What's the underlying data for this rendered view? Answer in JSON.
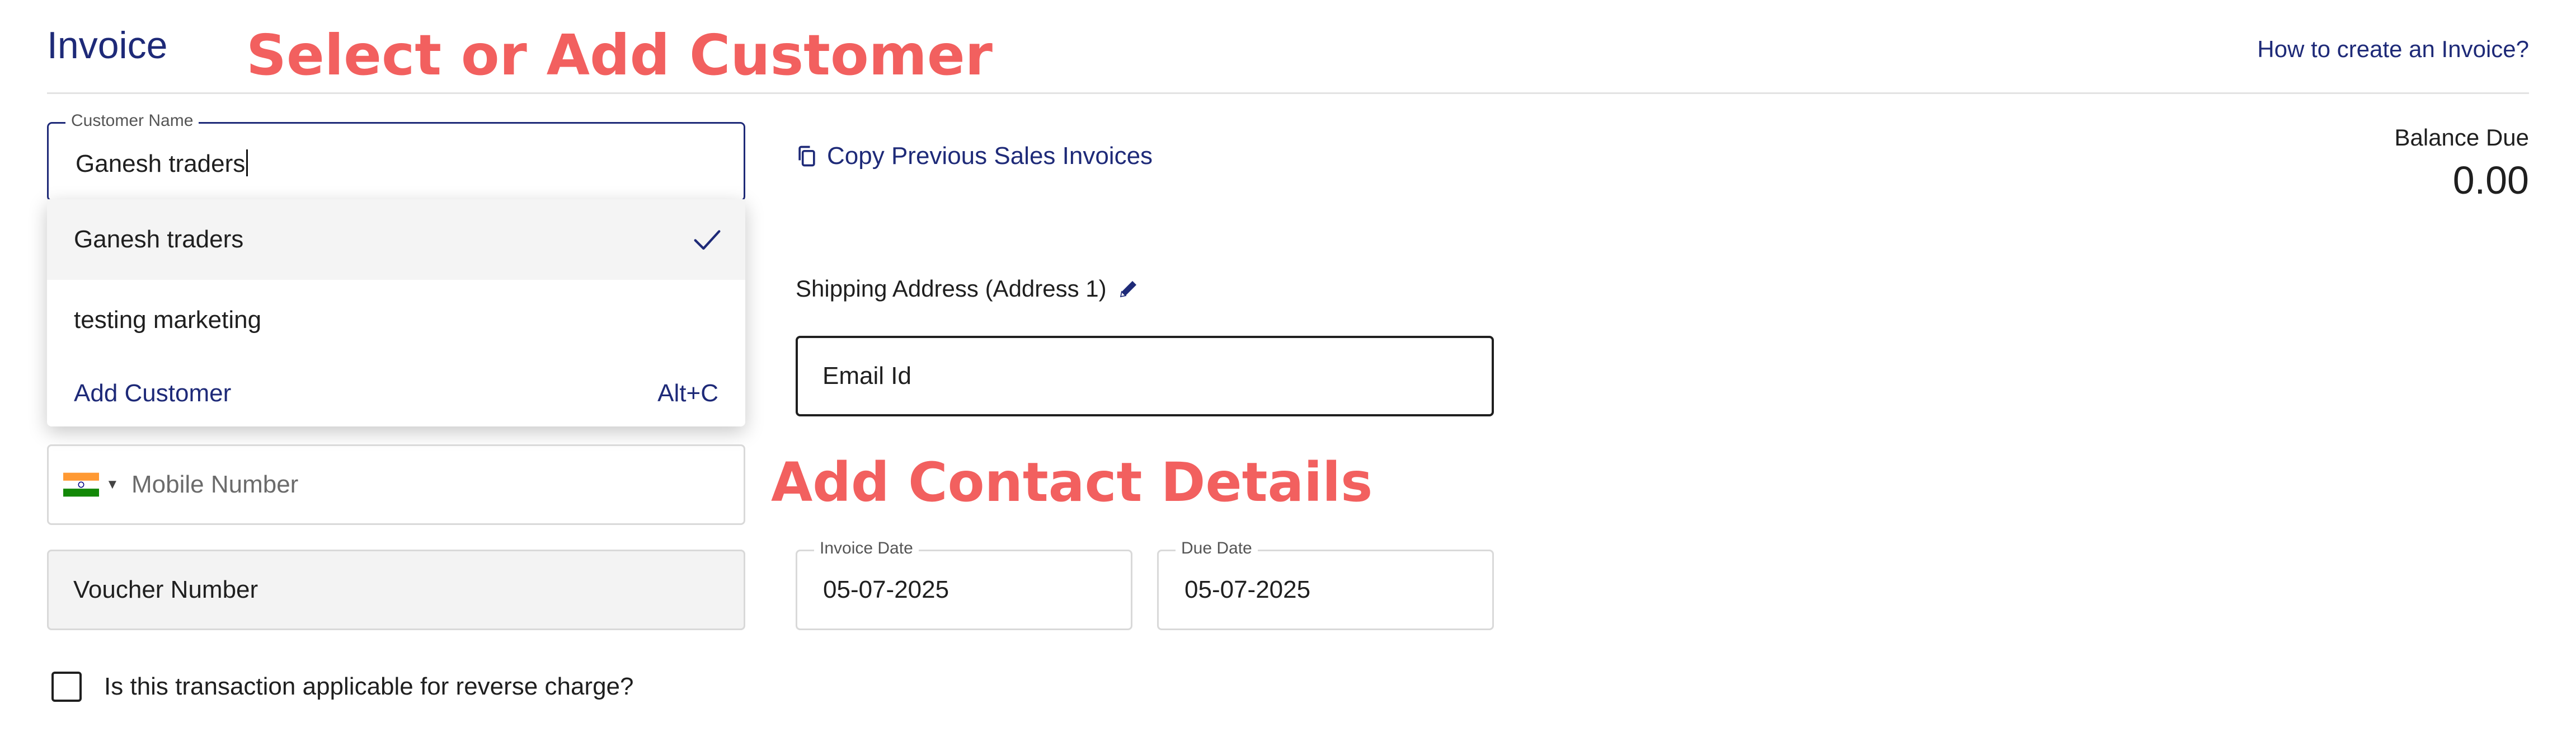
{
  "header": {
    "title": "Invoice",
    "help_link": "How to create an Invoice?"
  },
  "annotations": {
    "select_customer": "Select or Add Customer",
    "add_contact": "Add Contact Details",
    "color": "#f2605f"
  },
  "customer": {
    "label": "Customer Name",
    "value": "Ganesh traders",
    "dropdown": {
      "items": [
        {
          "label": "Ganesh traders",
          "selected": true
        },
        {
          "label": "testing marketing",
          "selected": false
        }
      ],
      "add_label": "Add Customer",
      "add_shortcut": "Alt+C"
    }
  },
  "copy_previous": {
    "label": "Copy Previous Sales Invoices",
    "icon": "copy-icon"
  },
  "balance": {
    "label": "Balance Due",
    "value": "0.00"
  },
  "shipping": {
    "label": "Shipping Address (Address 1)",
    "icon": "pencil-icon"
  },
  "email": {
    "placeholder": "Email Id"
  },
  "mobile": {
    "placeholder": "Mobile Number",
    "flag_icon": "india-flag-icon"
  },
  "voucher": {
    "placeholder": "Voucher Number"
  },
  "invoice_date": {
    "label": "Invoice Date",
    "value": "05-07-2025"
  },
  "due_date": {
    "label": "Due Date",
    "value": "05-07-2025"
  },
  "reverse_charge": {
    "label": "Is this transaction applicable for reverse charge?",
    "checked": false
  },
  "colors": {
    "accent": "#1e2a78",
    "annotation": "#f2605f"
  }
}
